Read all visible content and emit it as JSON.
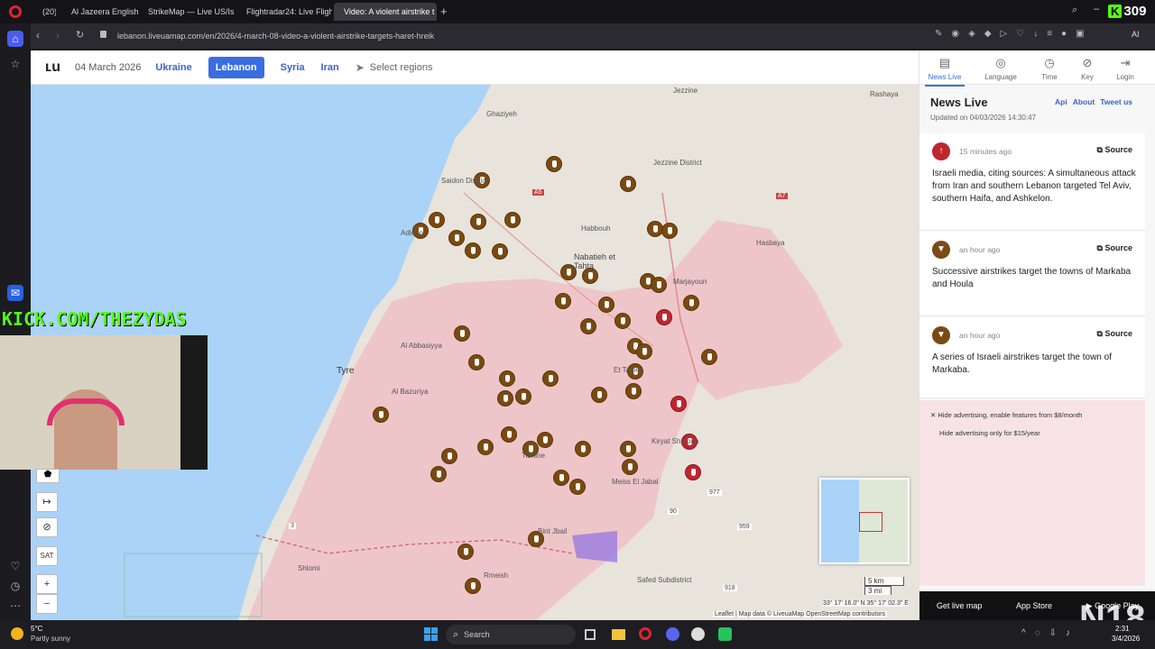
{
  "browser": {
    "tabs": [
      {
        "label": "(20)"
      },
      {
        "label": "Al Jazeera English"
      },
      {
        "label": "StrikeMap — Live US/Isra"
      },
      {
        "label": "Flightradar24: Live Flight"
      },
      {
        "label": "Video: A violent airstrike t"
      }
    ],
    "url": "lebanon.liveuamap.com/en/2026/4-march-08-video-a-violent-airstrike-targets-haret-hreik",
    "ai_label": "AI",
    "counter": "309"
  },
  "topnav": {
    "date": "04 March 2026",
    "links": [
      "Ukraine",
      "Lebanon",
      "Syria",
      "Iran"
    ],
    "select_regions": "Select regions"
  },
  "panel": {
    "tabs": [
      "News Live",
      "Language",
      "Time",
      "Key",
      "Login"
    ],
    "title": "News Live",
    "links": [
      "Api",
      "About",
      "Tweet us"
    ],
    "updated": "Updated on 04/03/2026 14:30:47",
    "source_label": "Source",
    "news": [
      {
        "time": "15 minutes ago",
        "text": "Israeli media, citing sources: A simultaneous attack from Iran and southern Lebanon targeted Tel Aviv, southern Haifa, and Ashkelon."
      },
      {
        "time": "an hour ago",
        "text": "Successive airstrikes target the towns of Markaba and Houla"
      },
      {
        "time": "an hour ago",
        "text": "A series of Israeli airstrikes target the town of Markaba."
      }
    ],
    "ad1": "Hide advertising, enable features from $8/month",
    "ad2": "Hide advertising only for $15/year",
    "footer": {
      "live": "Get live map",
      "app": "App Store",
      "google": "Google Play"
    }
  },
  "map": {
    "places": [
      "Ghaziyeh",
      "Jezzine District",
      "Saidon District",
      "Habbouh",
      "Nabatieh et Tahta",
      "Hasbaya",
      "Marjayoun",
      "Al Abbasiyya",
      "Tyre",
      "Al Bazuriya",
      "Et Taibeh",
      "Kiryat Shmona",
      "Tibnine",
      "Meiss El Jabal",
      "Bint Jbail",
      "Rmeish",
      "Shlomi",
      "Safed Subdistrict",
      "Jezzine",
      "Rashaya",
      "Adloun"
    ],
    "scale": [
      "5 km",
      "3 mi"
    ],
    "coords": "33° 17' 16.0\" N 35° 17' 02.3\" E",
    "attribution": "Leaflet | Map data © LiveuaMap OpenStreetMap contributors",
    "controls": [
      "SAT",
      "+",
      "−"
    ],
    "road_labels": [
      "A5",
      "A7",
      "977",
      "959",
      "918",
      "90",
      "3"
    ]
  },
  "stream": {
    "overlay_text": "KICK.COM/THEZYDAS",
    "n_logo": "N18"
  },
  "taskbar": {
    "weather_temp": "5°C",
    "weather_desc": "Partly sunny",
    "search": "Search",
    "time": "2:31",
    "date": "3/4/2026"
  }
}
